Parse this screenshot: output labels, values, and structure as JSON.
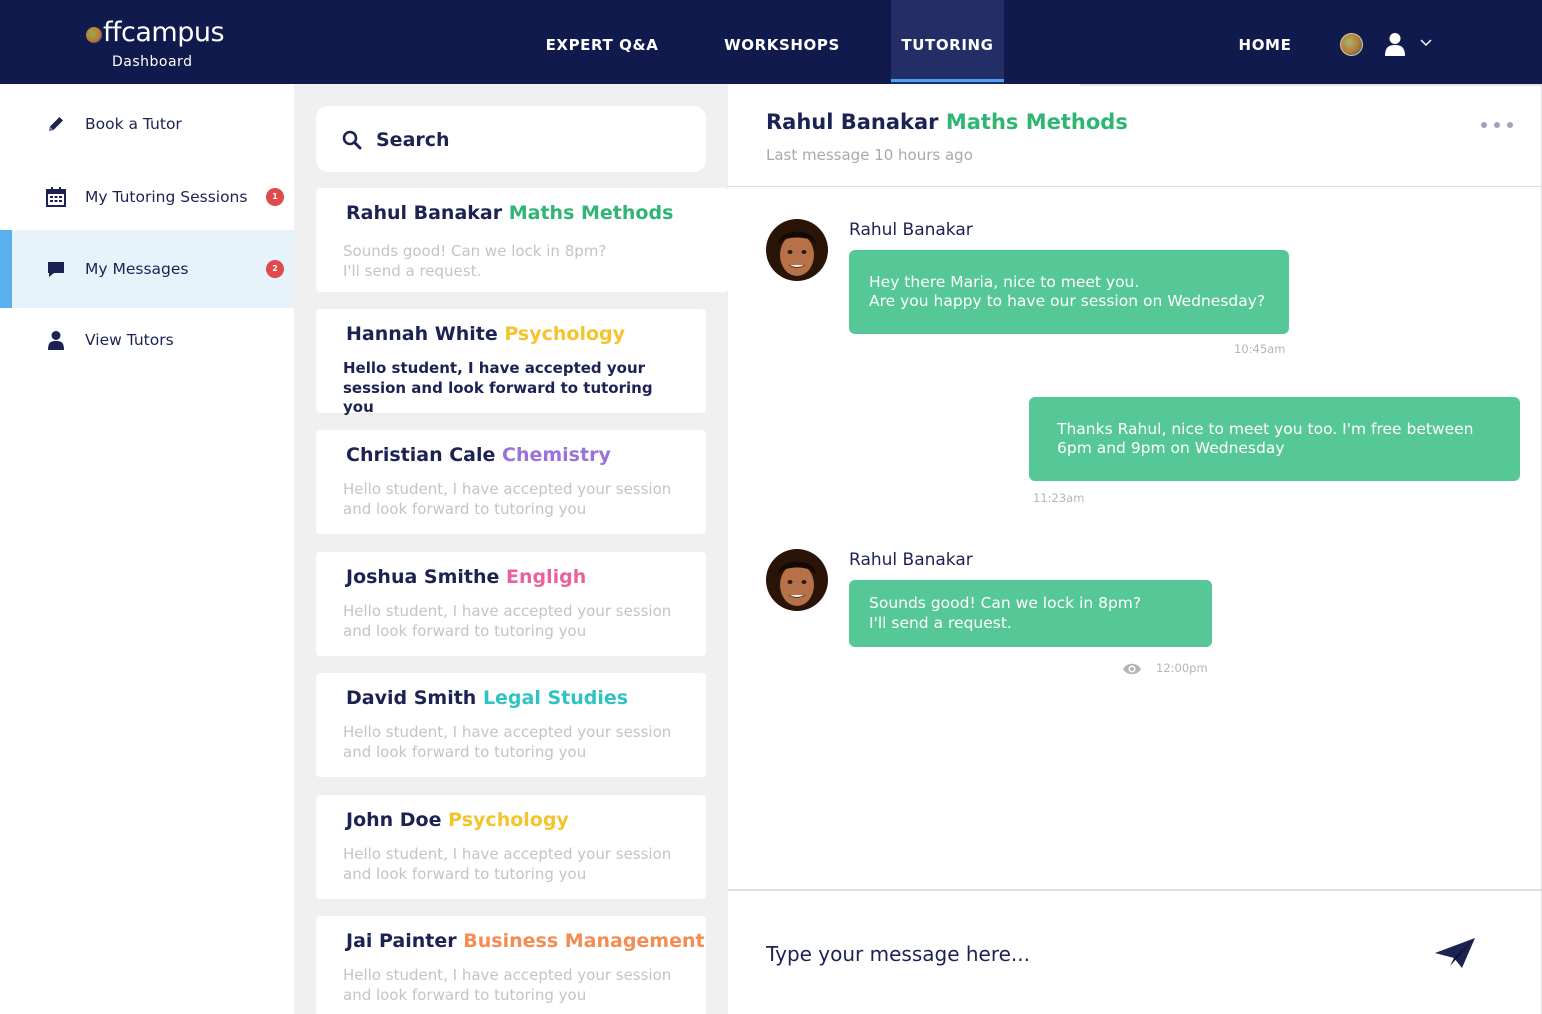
{
  "header": {
    "brand": "ffcampus",
    "subtitle": "Dashboard",
    "nav": [
      {
        "label": "EXPERT Q&A",
        "active": false
      },
      {
        "label": "WORKSHOPS",
        "active": false
      },
      {
        "label": "TUTORING",
        "active": true
      },
      {
        "label": "HOME",
        "active": false
      }
    ],
    "icons": [
      "globe-icon",
      "user-icon",
      "chevron-down-icon"
    ]
  },
  "sidebar": {
    "items": [
      {
        "label": "Book a Tutor",
        "icon": "pencil-icon",
        "badge": "",
        "active": false
      },
      {
        "label": "My Tutoring Sessions",
        "icon": "calendar-icon",
        "badge": "1",
        "active": false
      },
      {
        "label": "My Messages",
        "icon": "chat-bubble-icon",
        "badge": "2",
        "active": true
      },
      {
        "label": "View Tutors",
        "icon": "user-icon",
        "badge": "",
        "active": false
      }
    ]
  },
  "search": {
    "label": "Search"
  },
  "conversations": [
    {
      "name": "Rahul Banakar",
      "subject": "Maths Methods",
      "subject_color": "#2fb673",
      "preview": "Sounds good! Can we lock in 8pm?\nI'll send a request.",
      "unread": false,
      "active": true
    },
    {
      "name": "Hannah White",
      "subject": "Psychology",
      "subject_color": "#f5c42c",
      "preview": "Hello student, I have accepted your session and look forward to tutoring you",
      "unread": true,
      "active": false
    },
    {
      "name": "Christian Cale",
      "subject": "Chemistry",
      "subject_color": "#9b72d9",
      "preview": "Hello student, I have accepted your session and look forward to tutoring you",
      "unread": false,
      "active": false
    },
    {
      "name": "Joshua Smithe",
      "subject": "Engligh",
      "subject_color": "#e8639b",
      "preview": "Hello student, I have accepted your session and look forward to tutoring you",
      "unread": false,
      "active": false
    },
    {
      "name": "David Smith",
      "subject": "Legal Studies",
      "subject_color": "#2ec4c4",
      "preview": "Hello student, I have accepted your session and look forward to tutoring you",
      "unread": false,
      "active": false
    },
    {
      "name": "John Doe",
      "subject": "Psychology",
      "subject_color": "#f5c42c",
      "preview": "Hello student, I have accepted your session and look forward to tutoring you",
      "unread": false,
      "active": false
    },
    {
      "name": "Jai Painter",
      "subject": "Business Management",
      "subject_color": "#f58c52",
      "preview": "Hello student, I have accepted your session and look forward to tutoring you",
      "unread": false,
      "active": false
    }
  ],
  "chat": {
    "name": "Rahul Banakar",
    "subject": "Maths Methods",
    "subject_color": "#2fb673",
    "last_message": "Last message 10 hours ago",
    "messages": [
      {
        "from": "them",
        "sender": "Rahul Banakar",
        "text": "Hey there Maria, nice to meet you.\nAre you happy to have our session on Wednesday?",
        "time": "10:45am",
        "seen": false
      },
      {
        "from": "me",
        "sender": "",
        "text": "Thanks Rahul, nice to meet you too. I'm free between 6pm and 9pm on Wednesday",
        "time": "11:23am",
        "seen": false
      },
      {
        "from": "them",
        "sender": "Rahul Banakar",
        "text": "Sounds good! Can we lock in 8pm?\nI'll send a request.",
        "time": "12:00pm",
        "seen": true
      }
    ],
    "input_placeholder": "Type your message here...",
    "send_icon": "paper-plane-icon",
    "more_icon": "more-dots-icon"
  },
  "colors": {
    "nav_bg": "#111a4d",
    "bubble": "#56c796",
    "badge": "#e14a4a",
    "active_accent": "#5ab0ee"
  }
}
